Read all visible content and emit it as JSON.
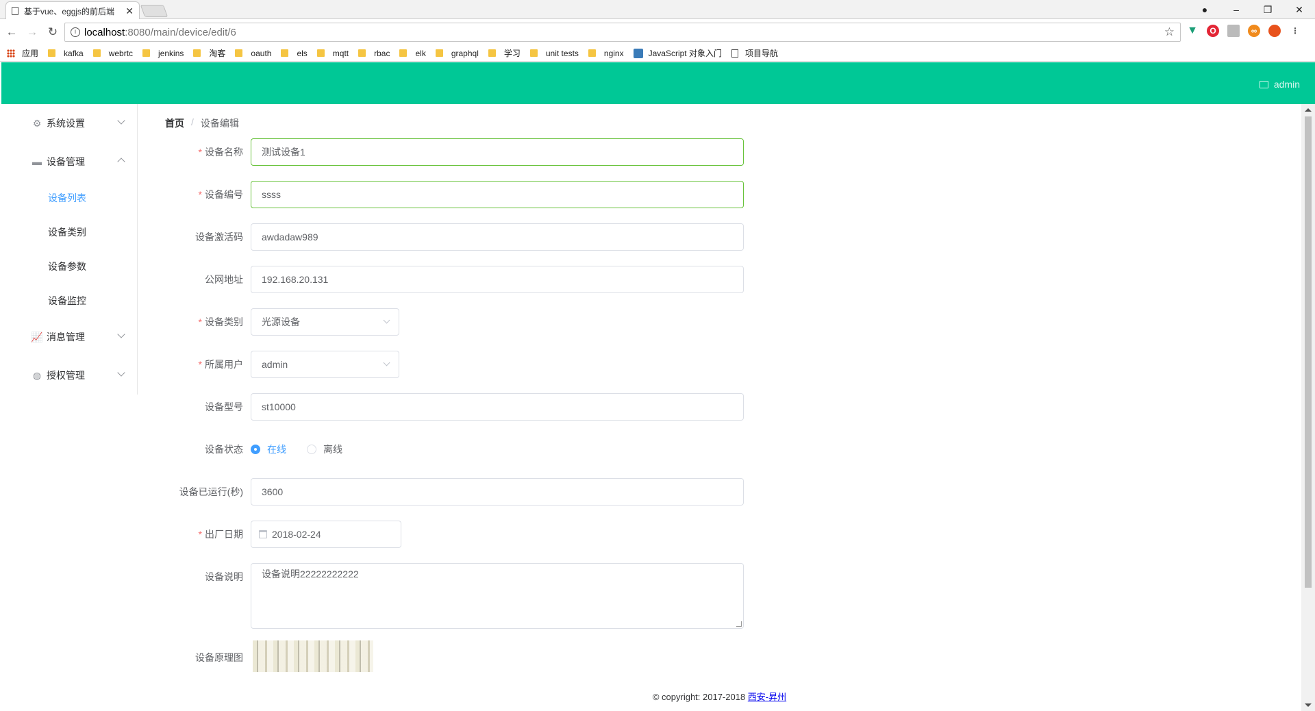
{
  "browser": {
    "tab_title": "基于vue、eggjs的前后端",
    "tab_close": "✕",
    "url_host": "localhost",
    "url_path": ":8080/main/device/edit/6",
    "window_controls": [
      "–",
      "❐",
      "✕"
    ],
    "bookmarks": [
      {
        "label": "应用",
        "icon": "apps-icon"
      },
      {
        "label": "kafka",
        "icon": "folder-icon"
      },
      {
        "label": "webrtc",
        "icon": "folder-icon"
      },
      {
        "label": "jenkins",
        "icon": "folder-icon"
      },
      {
        "label": "淘客",
        "icon": "folder-icon"
      },
      {
        "label": "oauth",
        "icon": "folder-icon"
      },
      {
        "label": "els",
        "icon": "folder-icon"
      },
      {
        "label": "mqtt",
        "icon": "folder-icon"
      },
      {
        "label": "rbac",
        "icon": "folder-icon"
      },
      {
        "label": "elk",
        "icon": "folder-icon"
      },
      {
        "label": "graphql",
        "icon": "folder-icon"
      },
      {
        "label": "学习",
        "icon": "folder-icon"
      },
      {
        "label": "unit tests",
        "icon": "folder-icon"
      },
      {
        "label": "nginx",
        "icon": "folder-icon"
      },
      {
        "label": "JavaScript 对象入门",
        "icon": "js-icon"
      },
      {
        "label": "项目导航",
        "icon": "page-icon"
      }
    ]
  },
  "header": {
    "user": "admin",
    "color": "#00c896"
  },
  "sidebar": {
    "items": [
      {
        "label": "系统设置",
        "icon": "gear-icon"
      },
      {
        "label": "设备管理",
        "icon": "device-icon"
      },
      {
        "label": "消息管理",
        "icon": "chart-icon"
      },
      {
        "label": "授权管理",
        "icon": "globe-icon"
      }
    ],
    "sub_items": [
      {
        "label": "设备列表",
        "active": true
      },
      {
        "label": "设备类别"
      },
      {
        "label": "设备参数"
      },
      {
        "label": "设备监控"
      }
    ]
  },
  "breadcrumb": {
    "home": "首页",
    "separator": "/",
    "current": "设备编辑"
  },
  "form": {
    "name": {
      "label": "设备名称",
      "value": "测试设备1",
      "required": true
    },
    "code": {
      "label": "设备编号",
      "value": "ssss",
      "required": true
    },
    "activation": {
      "label": "设备激活码",
      "value": "awdadaw989"
    },
    "ip": {
      "label": "公网地址",
      "value": "192.168.20.131"
    },
    "category": {
      "label": "设备类别",
      "value": "光源设备",
      "required": true
    },
    "owner": {
      "label": "所属用户",
      "value": "admin",
      "required": true
    },
    "model": {
      "label": "设备型号",
      "value": "st10000"
    },
    "status": {
      "label": "设备状态",
      "options": [
        "在线",
        "离线"
      ],
      "selected": "在线"
    },
    "uptime": {
      "label": "设备已运行(秒)",
      "value": "3600"
    },
    "date": {
      "label": "出厂日期",
      "value": "2018-02-24",
      "required": true
    },
    "desc": {
      "label": "设备说明",
      "value": "设备说明22222222222"
    },
    "diagram": {
      "label": "设备原理图"
    }
  },
  "footer": {
    "text": "© copyright: 2017-2018 ",
    "link": "西安-昇州"
  }
}
